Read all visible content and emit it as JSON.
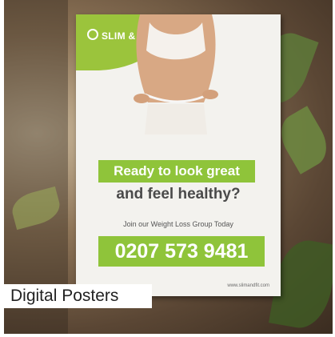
{
  "poster": {
    "brand": "SLIM & FIT",
    "headline_line1": "Ready to look great",
    "headline_line2": "and feel healthy?",
    "subtext": "Join our Weight Loss Group Today",
    "phone": "0207 573 9481",
    "url": "www.slimandfit.com"
  },
  "caption": "Digital Posters",
  "colors": {
    "accent": "#8fc43a",
    "headline_dark": "#4a4a4a",
    "poster_bg": "#f3f2ee"
  },
  "icons": [
    "apple-logo-icon"
  ]
}
